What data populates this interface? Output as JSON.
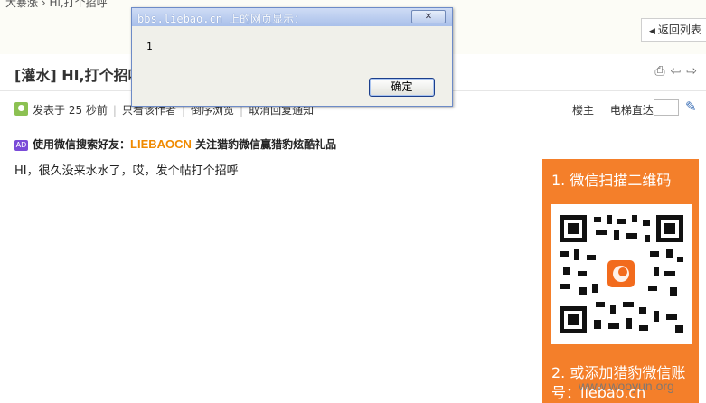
{
  "breadcrumb": {
    "home": "大暴涨",
    "sep": "›",
    "current": "Hi,打个招呼"
  },
  "header": {
    "back_button": "返回列表"
  },
  "thread": {
    "title": "[灌水] HI,打个招呼",
    "posted": "发表于 25 秒前",
    "only_author": "只看该作者",
    "reverse": "倒序浏览",
    "cancel_notify": "取消回复通知",
    "floor_owner": "楼主",
    "jump_label": "电梯直达",
    "jump_value": ""
  },
  "ad": {
    "badge": "AD",
    "prefix": "使用微信搜索好友：",
    "highlight": "LIEBAOCN",
    "suffix": " 关注猎豹微信赢猎豹炫酷礼品"
  },
  "post": {
    "body": "HI，很久没来水水了，哎，发个帖打个招呼"
  },
  "promo": {
    "step1": "1. 微信扫描二维码",
    "step2": "2. 或添加猎豹微信账号：liebao.cn"
  },
  "watermark": "www.wooyun.org",
  "dialog": {
    "title": "bbs.liebao.cn 上的网页显示：",
    "close": "✕",
    "message": "1",
    "ok_label": "确定"
  },
  "colors": {
    "promo_orange": "#f47f2a",
    "ad_highlight": "#f08a00",
    "author_icon": "#8cc152"
  },
  "icons": [
    "print-icon",
    "prev-icon",
    "next-icon",
    "wrench-icon",
    "author-icon",
    "ad-badge-icon",
    "qr-code-icon"
  ]
}
